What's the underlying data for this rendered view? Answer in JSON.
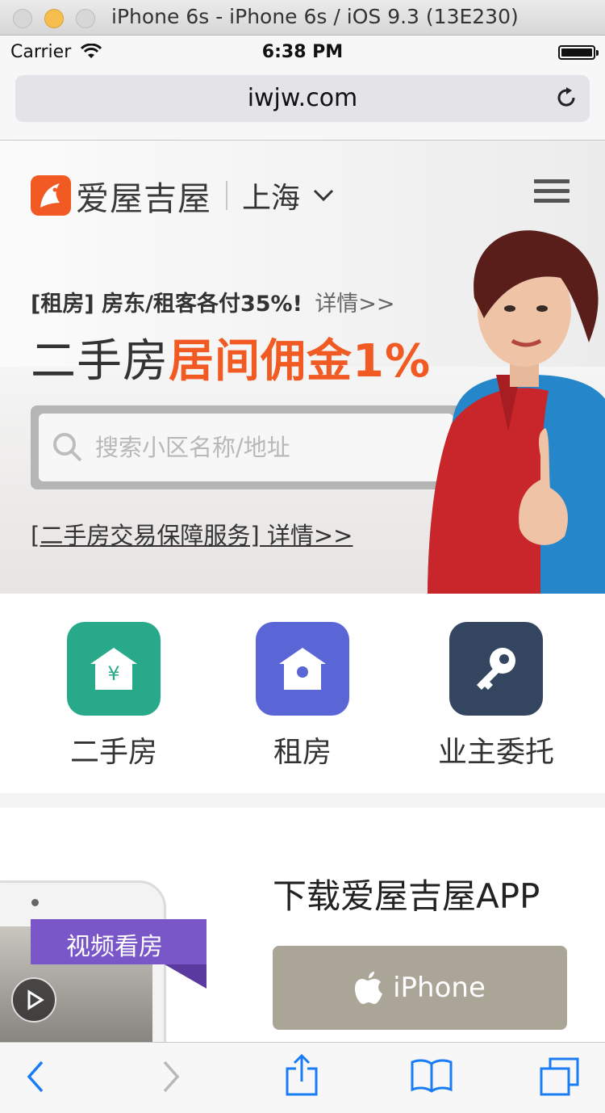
{
  "simulator": {
    "title": "iPhone 6s - iPhone 6s / iOS 9.3 (13E230)"
  },
  "statusbar": {
    "carrier": "Carrier",
    "time": "6:38 PM",
    "battery_level": 1.0
  },
  "browser": {
    "url": "iwjw.com"
  },
  "header": {
    "logo_text": "爱屋吉屋",
    "city": "上海"
  },
  "hero": {
    "promo_tag": "[租房]",
    "promo_text": "房东/租客各付35%!",
    "promo_link": "详情>>",
    "headline_plain": "二手房",
    "headline_accent": "居间佣金1%",
    "search_placeholder": "搜索小区名称/地址",
    "guarantee_link": "[二手房交易保障服务] 详情>>"
  },
  "categories": [
    {
      "label": "二手房",
      "color": "#27a98a",
      "icon": "house-yen-icon"
    },
    {
      "label": "租房",
      "color": "#5b66d6",
      "icon": "birdhouse-icon"
    },
    {
      "label": "业主委托",
      "color": "#34465f",
      "icon": "key-icon"
    }
  ],
  "app_download": {
    "title": "下载爱屋吉屋APP",
    "video_tag": "视频看房",
    "iphone_button": "iPhone"
  },
  "colors": {
    "brand_orange": "#f15a22",
    "ios_blue": "#1a7cf5"
  }
}
